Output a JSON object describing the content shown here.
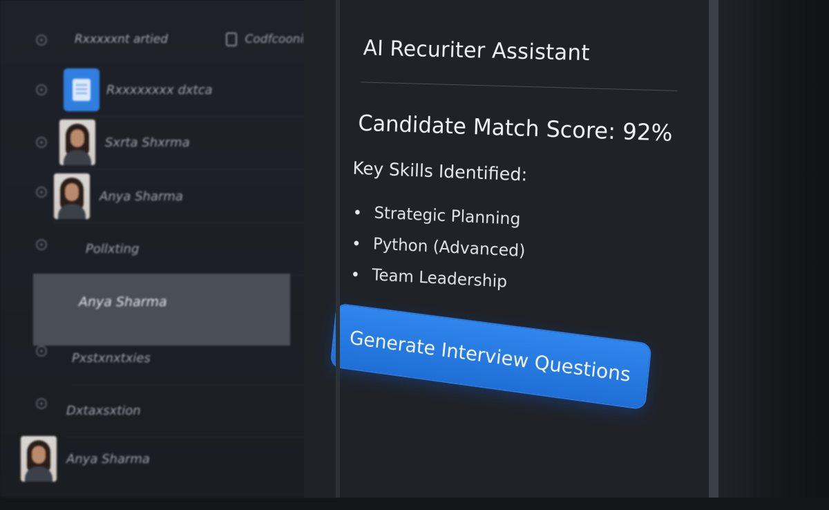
{
  "list_panel": {
    "header_left": "Rxxxxxnt artied",
    "header_right": "Codfcoonin",
    "rows": [
      {
        "label": "Rxxxxxxxx dxtca"
      },
      {
        "label": "Sxrta Shxrma"
      },
      {
        "label": "Anya Sharma"
      },
      {
        "label": "Pollxting"
      },
      {
        "label": "Anya Sharma"
      },
      {
        "label": "Pxstxnxtxies"
      },
      {
        "label": "Dxtaxsxtion"
      },
      {
        "label": "Anya Sharma"
      }
    ]
  },
  "assistant": {
    "title": "AI Recuriter Assistant",
    "match_score": "Candidate Match Score: 92%",
    "skills_heading": "Key Skills Identified:",
    "skills": [
      {
        "label": "Strategic Planning"
      },
      {
        "label": "Python (Advanced)"
      },
      {
        "label": "Team Leadership"
      }
    ],
    "generate_button": "Generate Interview Questions"
  },
  "colors": {
    "background": "#131518",
    "panel": "#1f2227",
    "accent": "#2f86ec",
    "selected_row": "#4a4f57"
  }
}
